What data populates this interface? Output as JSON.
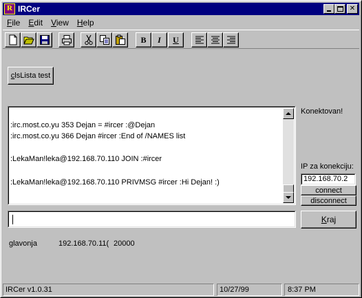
{
  "window": {
    "title": "IRCer",
    "icon": "ircer-app-icon"
  },
  "menu": [
    {
      "label": "File",
      "accel": "F",
      "rest": "ile"
    },
    {
      "label": "Edit",
      "accel": "E",
      "rest": "dit"
    },
    {
      "label": "View",
      "accel": "V",
      "rest": "iew"
    },
    {
      "label": "Help",
      "accel": "H",
      "rest": "elp"
    }
  ],
  "toolbar": {
    "bold": "B",
    "italic": "I",
    "underline": "U"
  },
  "cls_button": {
    "label": "clsLista test",
    "accel": "c",
    "rest": "lsLista test"
  },
  "log": {
    "lines": [
      "",
      ":irc.most.co.yu 353 Dejan = #ircer :@Dejan",
      ":irc.most.co.yu 366 Dejan #ircer :End of /NAMES list",
      "",
      ":LekaMan!leka@192.168.70.110 JOIN :#ircer",
      "",
      ":LekaMan!leka@192.168.70.110 PRIVMSG #ircer :Hi Dejan! :)",
      ""
    ]
  },
  "status_label": "Konektovan!",
  "ip_label": "IP za konekciju:",
  "ip_value": "192.168.70.2",
  "connect_button": "connect",
  "disconnect_button": "disconnect",
  "message_input": "",
  "kraj_button": {
    "label": "Kraj",
    "accel": "K",
    "rest": "raj"
  },
  "peer": {
    "name": "glavonja",
    "ip": "192.168.70.11(",
    "port": "20000"
  },
  "statusbar": {
    "version": "IRCer v1.0.31",
    "date": "10/27/99",
    "time": "8:37 PM"
  }
}
